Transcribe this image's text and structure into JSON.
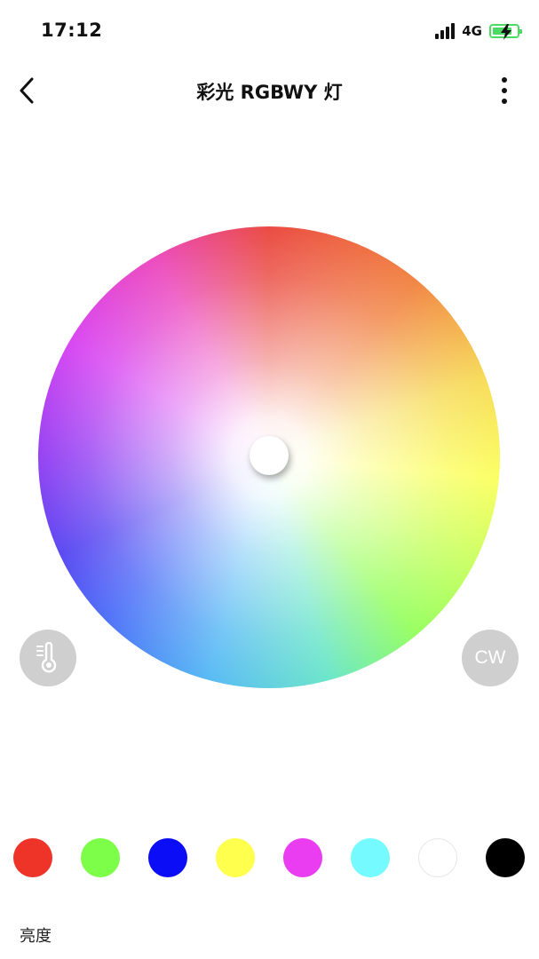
{
  "status_bar": {
    "time": "17:12",
    "network": "4G",
    "battery_color": "#4cd964"
  },
  "nav": {
    "title": "彩光 RGBWY 灯",
    "back_icon": "chevron-left-icon",
    "more_icon": "more-vertical-icon"
  },
  "color_wheel": {
    "knob_color": "#ffffff"
  },
  "side_buttons": {
    "temperature_icon": "thermometer-icon",
    "cw_label": "CW",
    "bg_color": "#cfcfcf"
  },
  "swatches": [
    {
      "name": "red",
      "color": "#ee3328"
    },
    {
      "name": "green",
      "color": "#7dff4a"
    },
    {
      "name": "blue",
      "color": "#0a0df5"
    },
    {
      "name": "yellow",
      "color": "#ffff4d"
    },
    {
      "name": "magenta",
      "color": "#ea3cf0"
    },
    {
      "name": "cyan",
      "color": "#75fbff"
    },
    {
      "name": "white",
      "color": "#ffffff"
    },
    {
      "name": "black",
      "color": "#000000"
    }
  ],
  "brightness": {
    "label": "亮度"
  }
}
